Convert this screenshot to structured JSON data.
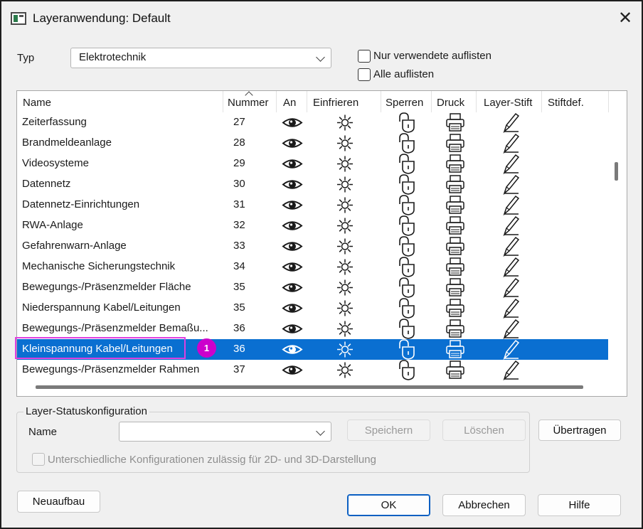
{
  "window": {
    "title": "Layeranwendung: Default",
    "close_glyph": "✕"
  },
  "typ": {
    "label": "Typ",
    "value": "Elektrotechnik"
  },
  "options": {
    "nur_verwendete": "Nur verwendete auflisten",
    "alle": "Alle auflisten"
  },
  "table": {
    "columns": [
      "Name",
      "Nummer",
      "An",
      "Einfrieren",
      "Sperren",
      "Druck",
      "Layer-Stift",
      "Stiftdef."
    ],
    "rows": [
      {
        "name": "Zeiterfassung",
        "num": "27"
      },
      {
        "name": "Brandmeldeanlage",
        "num": "28"
      },
      {
        "name": "Videosysteme",
        "num": "29"
      },
      {
        "name": "Datennetz",
        "num": "30"
      },
      {
        "name": "Datennetz-Einrichtungen",
        "num": "31"
      },
      {
        "name": "RWA-Anlage",
        "num": "32"
      },
      {
        "name": "Gefahrenwarn-Anlage",
        "num": "33"
      },
      {
        "name": "Mechanische Sicherungstechnik",
        "num": "34"
      },
      {
        "name": "Bewegungs-/Präsenzmelder Fläche",
        "num": "35"
      },
      {
        "name": "Niederspannung Kabel/Leitungen",
        "num": "35"
      },
      {
        "name": "Bewegungs-/Präsenzmelder Bemaßu...",
        "num": "36"
      },
      {
        "name": "Kleinspannung Kabel/Leitungen",
        "num": "36",
        "selected": true
      },
      {
        "name": "Bewegungs-/Präsenzmelder Rahmen",
        "num": "37"
      }
    ],
    "row_icons": [
      "eye-icon",
      "sun-icon",
      "lock-open-icon",
      "printer-icon",
      "pen-icon"
    ],
    "selection_color": "#0a6fd1"
  },
  "annotation": {
    "badge": "1",
    "color": "#cc00cc"
  },
  "config": {
    "legend": "Layer-Statuskonfiguration",
    "name_label": "Name",
    "name_value": "",
    "save": "Speichern",
    "delete": "Löschen",
    "transfer": "Übertragen",
    "checkbox": "Unterschiedliche Konfigurationen zulässig für 2D- und 3D-Darstellung"
  },
  "footer": {
    "rebuild": "Neuaufbau",
    "ok": "OK",
    "cancel": "Abbrechen",
    "help": "Hilfe"
  }
}
